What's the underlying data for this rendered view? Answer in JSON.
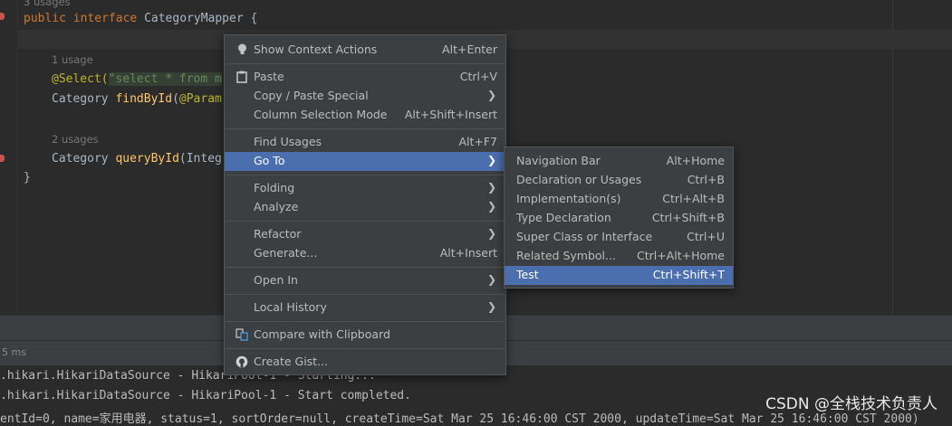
{
  "editor": {
    "usages_top": "3 usages",
    "line_interface": [
      "public",
      " ",
      "interface",
      " CategoryMapper {"
    ],
    "hint_1": "1 usage",
    "select_annotation": "@Select(",
    "select_string": "\"select * from m",
    "find_line_type": "Category ",
    "find_line_method": "findById",
    "find_line_param_open": "(",
    "find_line_param": "@Param",
    "hint_2": "2 usages",
    "query_line_type": "Category ",
    "query_line_method": "queryById",
    "query_line_rest": "(Integ",
    "closing_brace": "}"
  },
  "console": {
    "run_time": "5 ms",
    "line1": ".hikari.HikariDataSource - HikariPool-1 - Starting...",
    "line2": ".hikari.HikariDataSource - HikariPool-1 - Start completed.",
    "line3": "entId=0, name=家用电器, status=1, sortOrder=null, createTime=Sat Mar 25 16:46:00 CST 2000, updateTime=Sat Mar 25 16:46:00 CST 2000)",
    "watermark": "CSDN @全栈技术负责人"
  },
  "context_menu": {
    "items": [
      {
        "label": "Show Context Actions",
        "shortcut": "Alt+Enter",
        "icon": "bulb-icon"
      },
      {
        "label": "Paste",
        "shortcut": "Ctrl+V",
        "icon": "clipboard-icon"
      },
      {
        "label": "Copy / Paste Special",
        "submenu": true
      },
      {
        "label": "Column Selection Mode",
        "shortcut": "Alt+Shift+Insert"
      },
      {
        "label": "Find Usages",
        "shortcut": "Alt+F7"
      },
      {
        "label": "Go To",
        "submenu": true,
        "selected": true
      },
      {
        "label": "Folding",
        "submenu": true
      },
      {
        "label": "Analyze",
        "submenu": true
      },
      {
        "label": "Refactor",
        "submenu": true
      },
      {
        "label": "Generate...",
        "shortcut": "Alt+Insert"
      },
      {
        "label": "Open In",
        "submenu": true
      },
      {
        "label": "Local History",
        "submenu": true
      },
      {
        "label": "Compare with Clipboard",
        "icon": "compare-icon"
      },
      {
        "label": "Create Gist...",
        "icon": "github-icon"
      }
    ]
  },
  "goto_submenu": {
    "items": [
      {
        "label": "Navigation Bar",
        "shortcut": "Alt+Home"
      },
      {
        "label": "Declaration or Usages",
        "shortcut": "Ctrl+B"
      },
      {
        "label": "Implementation(s)",
        "shortcut": "Ctrl+Alt+B"
      },
      {
        "label": "Type Declaration",
        "shortcut": "Ctrl+Shift+B"
      },
      {
        "label": "Super Class or Interface",
        "shortcut": "Ctrl+U"
      },
      {
        "label": "Related Symbol...",
        "shortcut": "Ctrl+Alt+Home"
      },
      {
        "label": "Test",
        "shortcut": "Ctrl+Shift+T",
        "selected": true
      }
    ]
  },
  "colors": {
    "menu_bg": "#3c3f41",
    "selection": "#4b6eaf",
    "editor_bg": "#2b2b2b"
  }
}
